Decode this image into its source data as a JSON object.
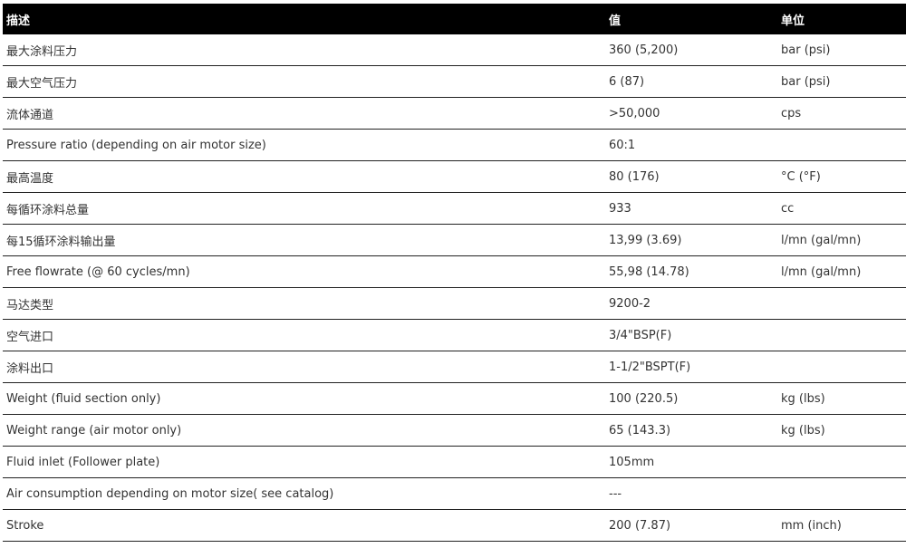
{
  "table": {
    "headers": [
      "描述",
      "值",
      "单位"
    ],
    "rows": [
      [
        "最大涂料压力",
        "360 (5,200)",
        "bar (psi)"
      ],
      [
        "最大空气压力",
        "6 (87)",
        "bar (psi)"
      ],
      [
        "流体通道",
        ">50,000",
        "cps"
      ],
      [
        "Pressure ratio (depending on air motor size)",
        "60:1",
        ""
      ],
      [
        "最高温度",
        "80 (176)",
        "°C (°F)"
      ],
      [
        "每循环涂料总量",
        "933",
        "cc"
      ],
      [
        "每15循环涂料输出量",
        "13,99 (3.69)",
        "l/mn (gal/mn)"
      ],
      [
        "Free flowrate (@ 60 cycles/mn)",
        "55,98 (14.78)",
        "l/mn (gal/mn)"
      ],
      [
        "马达类型",
        "9200-2",
        ""
      ],
      [
        "空气进口",
        "3/4\"BSP(F)",
        ""
      ],
      [
        "涂料出口",
        "1-1/2\"BSPT(F)",
        ""
      ],
      [
        "Weight (fluid section only)",
        "100 (220.5)",
        "kg (lbs)"
      ],
      [
        "Weight range (air motor only)",
        "65 (143.3)",
        "kg (lbs)"
      ],
      [
        "Fluid inlet (Follower plate)",
        "105mm",
        ""
      ],
      [
        "Air consumption depending on motor size( see catalog)",
        "---",
        ""
      ],
      [
        "Stroke",
        "200 (7.87)",
        "mm (inch)"
      ]
    ]
  }
}
